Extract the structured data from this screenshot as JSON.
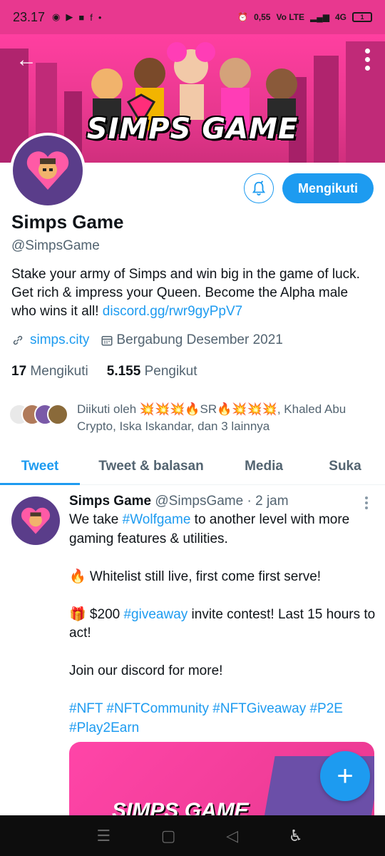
{
  "status_bar": {
    "time": "23.17",
    "net_speed": "0,55",
    "net_unit": "KB/S",
    "network": "Vo LTE",
    "signal": "4G",
    "battery": "1"
  },
  "banner": {
    "title": "SIMPS GAME"
  },
  "profile": {
    "name": "Simps Game",
    "handle": "@SimpsGame",
    "bio": "Stake your army of Simps and win big in the game of luck. Get rich & impress your Queen. Become the Alpha male who wins it all! ",
    "bio_link": "discord.gg/rwr9gyPpV7",
    "website": "simps.city",
    "joined": "Bergabung Desember 2021",
    "following_count": "17",
    "following_label": "Mengikuti",
    "followers_count": "5.155",
    "followers_label": "Pengikut",
    "followed_by": "Diikuti oleh 💥💥💥🔥SR🔥💥💥💥, Khaled Abu Crypto, Iska Iskandar, dan 3 lainnya",
    "follow_button": "Mengikuti"
  },
  "tabs": [
    {
      "label": "Tweet",
      "active": true
    },
    {
      "label": "Tweet & balasan",
      "active": false
    },
    {
      "label": "Media",
      "active": false
    },
    {
      "label": "Suka",
      "active": false
    }
  ],
  "tweet": {
    "name": "Simps Game",
    "handle": "@SimpsGame",
    "time": "· 2 jam",
    "line1_pre": "We take ",
    "line1_tag": "#Wolfgame",
    "line1_post": " to another level with more gaming features & utilities.",
    "line2": "🔥 Whitelist still live, first come first serve!",
    "line3_pre": "🎁 $200 ",
    "line3_tag": "#giveaway",
    "line3_post": " invite contest! Last 15 hours to act!",
    "line4": "Join our discord for more!",
    "hashtags": "#NFT #NFTCommunity #NFTGiveaway #P2E #Play2Earn",
    "media_title": "SIMPS GAME"
  },
  "fab": {
    "label": "+"
  },
  "colors": {
    "accent": "#1d9bf0",
    "banner": "#e8388f",
    "avatar_bg": "#5a3d8a"
  }
}
